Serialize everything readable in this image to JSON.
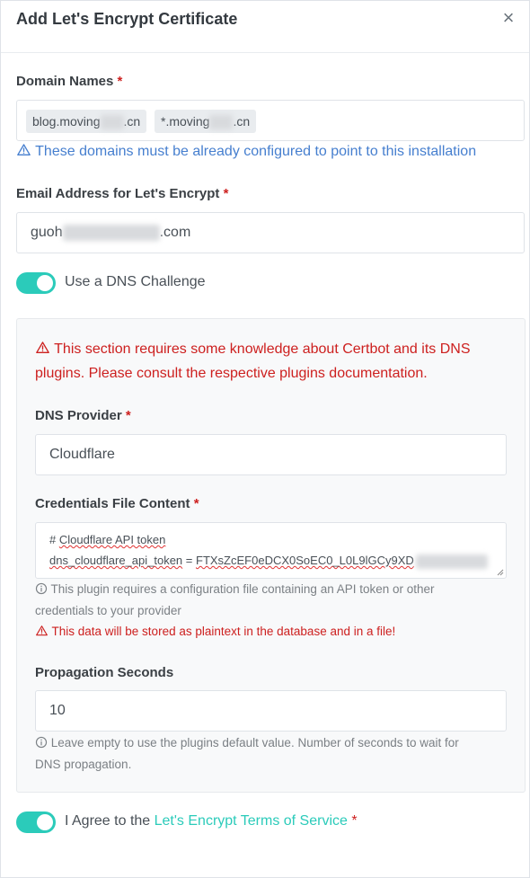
{
  "header": {
    "title": "Add Let's Encrypt Certificate",
    "close_symbol": "×"
  },
  "domain_names": {
    "label": "Domain Names",
    "required_mark": "*",
    "tags": [
      {
        "prefix": "blog.moving",
        "suffix": ".cn"
      },
      {
        "prefix": "*.moving",
        "suffix": ".cn"
      }
    ],
    "hint": "These domains must be already configured to point to this installation"
  },
  "email": {
    "label": "Email Address for Let's Encrypt",
    "required_mark": "*",
    "value_prefix": "guoh",
    "value_suffix": ".com"
  },
  "dns_challenge": {
    "label": "Use a DNS Challenge",
    "enabled": true
  },
  "dns_section": {
    "warning_line1": "This section requires some knowledge about Certbot and its DNS",
    "warning_line2": "plugins. Please consult the respective plugins documentation.",
    "provider": {
      "label": "DNS Provider",
      "required_mark": "*",
      "value": "Cloudflare"
    },
    "credentials": {
      "label": "Credentials File Content",
      "required_mark": "*",
      "line1_hash": "# ",
      "line1_text": "Cloudflare API token",
      "line2_key": "dns_cloudflare_api_token",
      "line2_eq": " = ",
      "line2_value": "FTXsZcEF0eDCX0SoEC0_L0L9lGCy9XD",
      "info_line1": "This plugin requires a configuration file containing an API token or other",
      "info_line2": "credentials to your provider",
      "warning": "This data will be stored as plaintext in the database and in a file!"
    },
    "propagation": {
      "label": "Propagation Seconds",
      "value": "10",
      "info_line1": "Leave empty to use the plugins default value. Number of seconds to wait for",
      "info_line2": "DNS propagation."
    }
  },
  "terms": {
    "prefix": "I Agree to the ",
    "link": "Let's Encrypt Terms of Service",
    "required_mark": "*",
    "enabled": true
  },
  "colors": {
    "accent": "#2bcbba",
    "danger": "#cd201f",
    "info": "#467fcf"
  }
}
